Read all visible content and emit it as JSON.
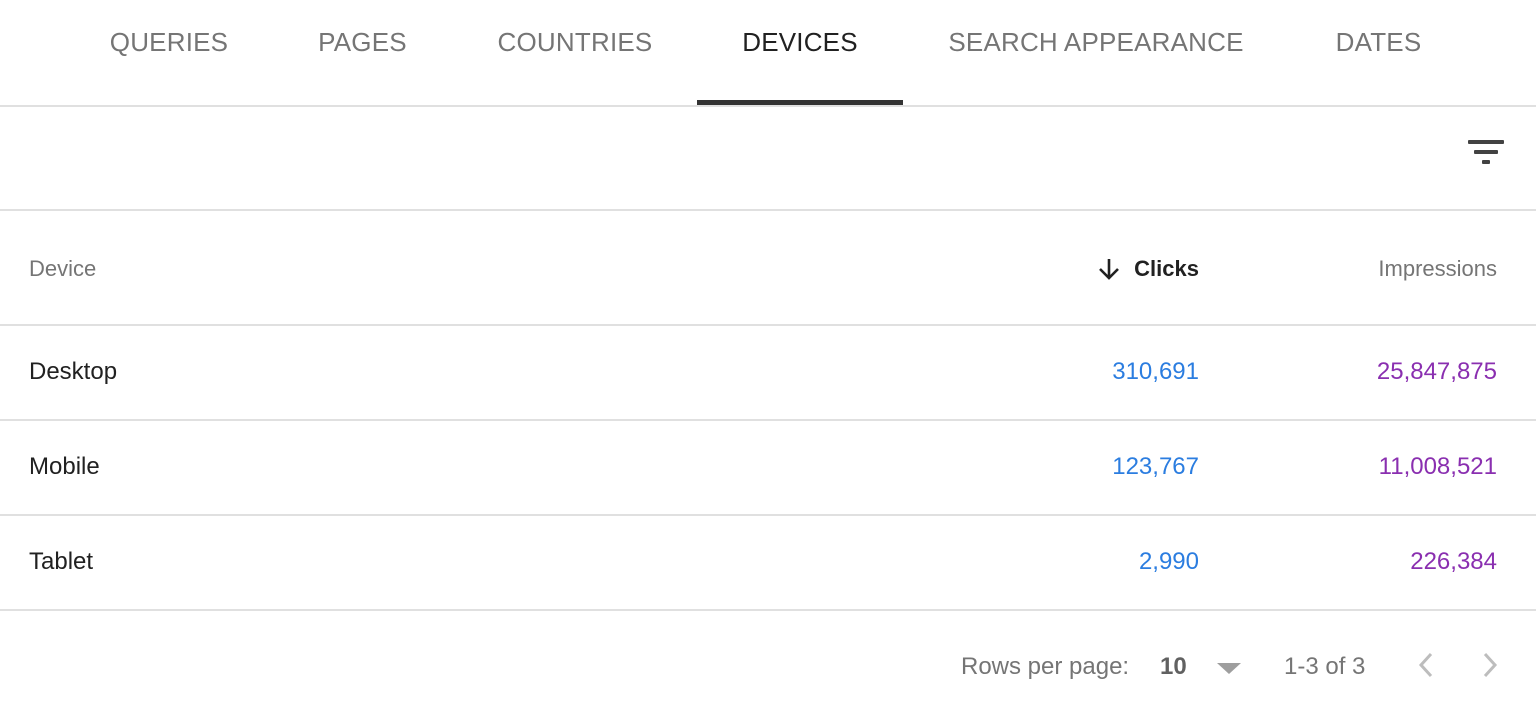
{
  "tabs": [
    {
      "label": "QUERIES",
      "active": false
    },
    {
      "label": "PAGES",
      "active": false
    },
    {
      "label": "COUNTRIES",
      "active": false
    },
    {
      "label": "DEVICES",
      "active": true
    },
    {
      "label": "SEARCH APPEARANCE",
      "active": false
    },
    {
      "label": "DATES",
      "active": false
    }
  ],
  "toolbar": {
    "filter_icon": "filter-list-icon"
  },
  "table": {
    "columns": {
      "device": "Device",
      "clicks": "Clicks",
      "impressions": "Impressions"
    },
    "sort": {
      "column": "Clicks",
      "direction": "descending",
      "icon": "arrow-down-icon"
    },
    "rows": [
      {
        "device": "Desktop",
        "clicks": "310,691",
        "impressions": "25,847,875"
      },
      {
        "device": "Mobile",
        "clicks": "123,767",
        "impressions": "11,008,521"
      },
      {
        "device": "Tablet",
        "clicks": "2,990",
        "impressions": "226,384"
      }
    ]
  },
  "pagination": {
    "rows_per_page_label": "Rows per page:",
    "rows_per_page_value": "10",
    "range": "1-3 of 3"
  },
  "colors": {
    "clicks": "#2b7de0",
    "impressions": "#8a2fb0",
    "active_tab": "#212121",
    "inactive_tab": "#757575"
  }
}
